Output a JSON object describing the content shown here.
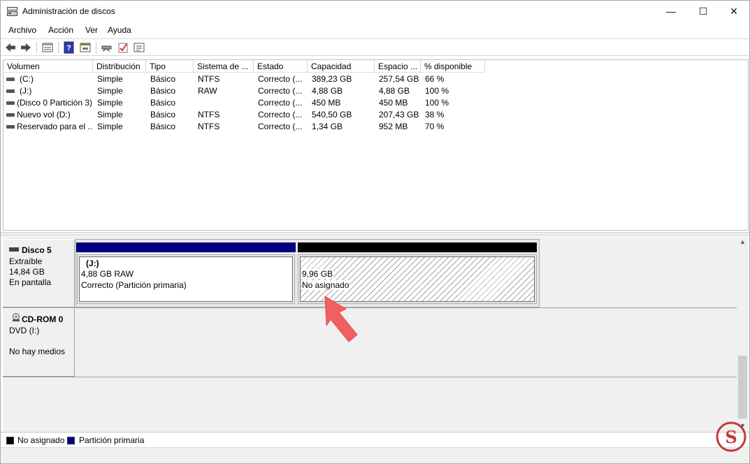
{
  "window": {
    "title": "Administración de discos",
    "minimize_glyph": "—",
    "maximize_glyph": "☐",
    "close_glyph": "✕"
  },
  "menu": [
    "Archivo",
    "Acción",
    "Ver",
    "Ayuda"
  ],
  "toolbar_icons": [
    "back-icon",
    "forward-icon",
    "list-view-icon",
    "help-icon",
    "properties-icon",
    "connect-icon",
    "check-icon",
    "settings-icon"
  ],
  "columns": [
    "Volumen",
    "Distribución",
    "Tipo",
    "Sistema de ...",
    "Estado",
    "Capacidad",
    "Espacio ...",
    "% disponible"
  ],
  "volumes": [
    [
      "(C:)",
      "Simple",
      "Básico",
      "NTFS",
      "Correcto (...",
      "389,23 GB",
      "257,54 GB",
      "66 %"
    ],
    [
      "(J:)",
      "Simple",
      "Básico",
      "RAW",
      "Correcto (...",
      "4,88 GB",
      "4,88 GB",
      "100 %"
    ],
    [
      "(Disco 0 Partición 3)",
      "Simple",
      "Básico",
      "",
      "Correcto (...",
      "450 MB",
      "450 MB",
      "100 %"
    ],
    [
      "Nuevo vol (D:)",
      "Simple",
      "Básico",
      "NTFS",
      "Correcto (...",
      "540,50 GB",
      "207,43 GB",
      "38 %"
    ],
    [
      "Reservado para el ...",
      "Simple",
      "Básico",
      "NTFS",
      "Correcto (...",
      "1,34 GB",
      "952 MB",
      "70 %"
    ]
  ],
  "disks": {
    "disk5": {
      "name": "Disco 5",
      "type": "Extraíble",
      "size": "14,84 GB",
      "status": "En pantalla",
      "partitions": [
        {
          "label": "(J:)",
          "size": "4,88 GB RAW",
          "status": "Correcto (Partición primaria)",
          "color": "#000080"
        },
        {
          "size": "9,96 GB",
          "status": "No asignado",
          "color": "#000000"
        }
      ]
    },
    "cdrom0": {
      "name": "CD-ROM 0",
      "type": "DVD (I:)",
      "status": "No hay medios"
    }
  },
  "legend": [
    {
      "label": "No asignado",
      "color": "#000000"
    },
    {
      "label": "Partición primaria",
      "color": "#000080"
    }
  ],
  "colors": {
    "pointer_arrow": "#f06060"
  }
}
